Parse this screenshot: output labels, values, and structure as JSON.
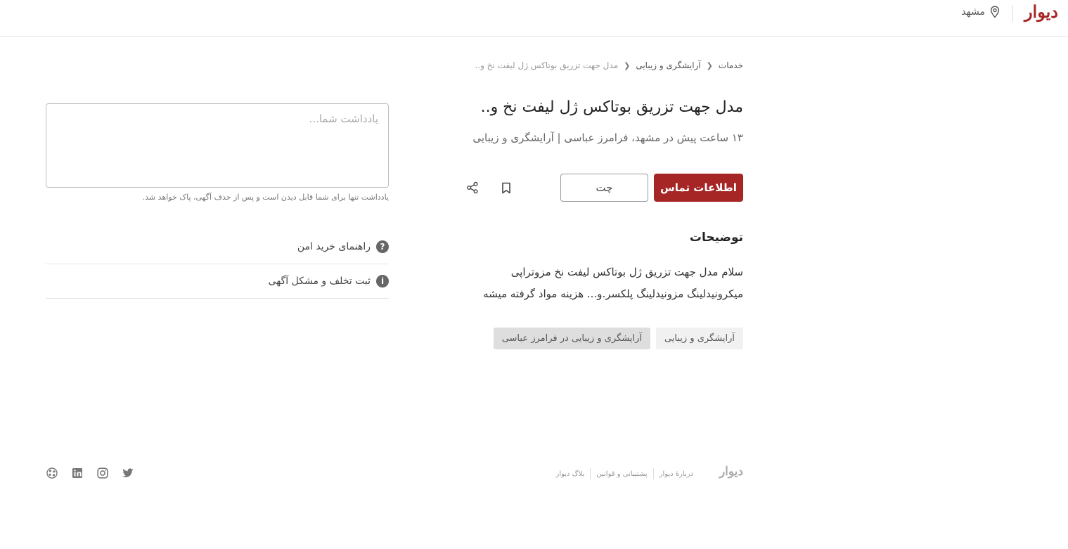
{
  "header": {
    "logo": "دیوار",
    "city": "مشهد"
  },
  "breadcrumb": {
    "items": [
      "خدمات",
      "آرایشگری و زیبایی"
    ],
    "current": "مدل جهت تزریق بوتاکس ژل لیفت نخ و.."
  },
  "post": {
    "title": "مدل جهت تزریق بوتاکس ژل لیفت نخ و..",
    "subtitle": "۱۳ ساعت پیش در مشهد، فرامرز عباسی | آرایشگری و زیبایی",
    "contact_label": "اطلاعات تماس",
    "chat_label": "چت",
    "description_title": "توضیحات",
    "description_lines": [
      "سلام مدل جهت تزریق ژل بوتاکس لیفت نخ مزوتراپی",
      "میکرونیدلینگ مزونیدلینگ پلکسر.و... هزینه مواد گرفته میشه"
    ],
    "tags": [
      "آرایشگری و زیبایی",
      "آرایشگری و زیبایی در فرامرز عباسی"
    ]
  },
  "note": {
    "placeholder": "یادداشت شما...",
    "hint": "یادداشت تنها برای شما قابل دیدن است و پس از حذف آگهی، پاک خواهد شد."
  },
  "side_links": [
    {
      "label": "راهنمای خرید امن",
      "icon": "?"
    },
    {
      "label": "ثبت تخلف و مشکل آگهی",
      "icon": "i"
    }
  ],
  "footer": {
    "logo": "دیوار",
    "links": [
      "دربارهٔ دیوار",
      "پشتیبانی و قوانین",
      "بلاگ دیوار"
    ]
  },
  "colors": {
    "brand": "#a62626"
  }
}
